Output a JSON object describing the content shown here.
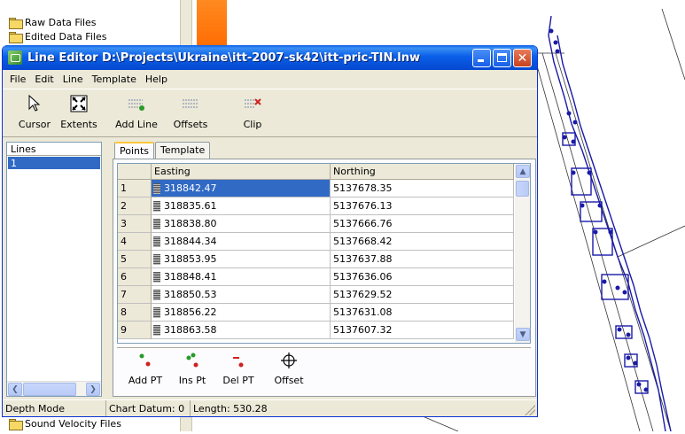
{
  "background": {
    "tree_items_top": [
      "Raw Data Files",
      "Edited Data Files"
    ],
    "tree_items_bottom": [
      "Sound Velocity Files"
    ],
    "accent_color": "#ff7a10"
  },
  "window": {
    "title": "Line Editor   D:\\Projects\\Ukraine\\itt-2007-sk42\\itt-pric-TIN.lnw",
    "titlebar_color": "#0a5fe8",
    "buttons": {
      "minimize": "minimize",
      "maximize": "maximize",
      "close": "✕"
    }
  },
  "menu": [
    "File",
    "Edit",
    "Line",
    "Template",
    "Help"
  ],
  "toolbar": {
    "cursor": "Cursor",
    "extents": "Extents",
    "add_line": "Add Line",
    "offsets": "Offsets",
    "clip": "Clip"
  },
  "lines_panel": {
    "header": "Lines",
    "items": [
      "1"
    ],
    "selected": "1"
  },
  "tabs": [
    "Points",
    "Template"
  ],
  "active_tab": "Points",
  "grid": {
    "columns": [
      "Easting",
      "Northing"
    ],
    "rows": [
      {
        "n": "1",
        "easting": "318842.47",
        "northing": "5137678.35"
      },
      {
        "n": "2",
        "easting": "318835.61",
        "northing": "5137676.13"
      },
      {
        "n": "3",
        "easting": "318838.80",
        "northing": "5137666.76"
      },
      {
        "n": "4",
        "easting": "318844.34",
        "northing": "5137668.42"
      },
      {
        "n": "5",
        "easting": "318853.95",
        "northing": "5137637.88"
      },
      {
        "n": "6",
        "easting": "318848.41",
        "northing": "5137636.06"
      },
      {
        "n": "7",
        "easting": "318850.53",
        "northing": "5137629.52"
      },
      {
        "n": "8",
        "easting": "318856.22",
        "northing": "5137631.08"
      },
      {
        "n": "9",
        "easting": "318863.58",
        "northing": "5137607.32"
      }
    ],
    "selected_row": "1"
  },
  "point_tools": {
    "add_pt": "Add PT",
    "ins_pt": "Ins Pt",
    "del_pt": "Del PT",
    "offset": "Offset"
  },
  "status": {
    "mode": "Depth Mode",
    "chart_datum": "Chart Datum: 0",
    "length": "Length: 530.28"
  }
}
